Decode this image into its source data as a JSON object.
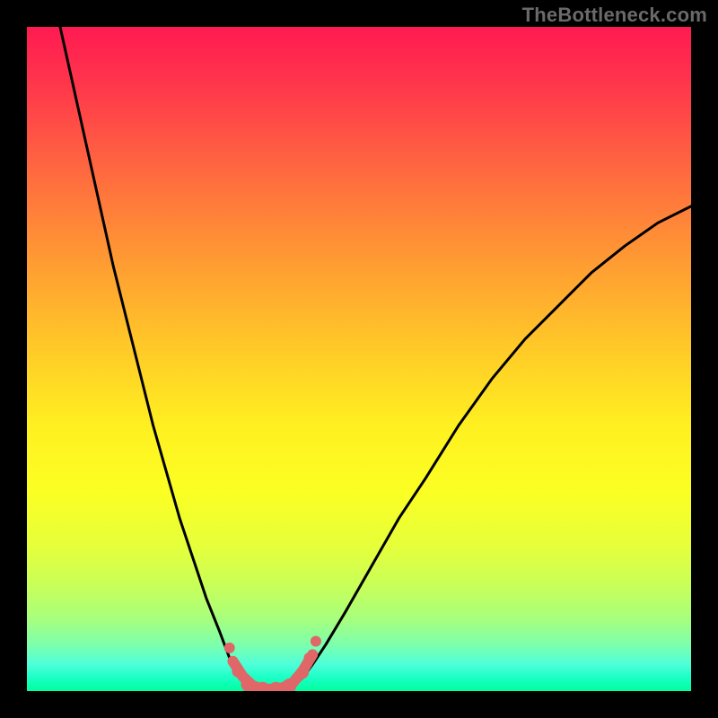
{
  "attribution": "TheBottleneck.com",
  "chart_data": {
    "type": "line",
    "title": "",
    "xlabel": "",
    "ylabel": "",
    "xlim": [
      0,
      100
    ],
    "ylim": [
      0,
      100
    ],
    "grid": false,
    "legend": false,
    "background_gradient": {
      "top": "#ff1a52",
      "mid": "#fff021",
      "bottom": "#00ff9c"
    },
    "series": [
      {
        "name": "left-branch",
        "stroke": "#000000",
        "x": [
          5,
          7,
          9,
          11,
          13,
          15,
          17,
          19,
          21,
          23,
          25,
          27,
          29,
          30.5,
          32,
          33,
          34
        ],
        "y": [
          100,
          91,
          82,
          73,
          64,
          56,
          48,
          40,
          33,
          26,
          20,
          14,
          9,
          5,
          3,
          1.5,
          0.5
        ]
      },
      {
        "name": "right-branch",
        "stroke": "#000000",
        "x": [
          40,
          41.5,
          43,
          45,
          48,
          52,
          56,
          60,
          65,
          70,
          75,
          80,
          85,
          90,
          95,
          100
        ],
        "y": [
          0.5,
          2,
          4,
          7,
          12,
          19,
          26,
          32,
          40,
          47,
          53,
          58,
          63,
          67,
          70.5,
          73
        ]
      },
      {
        "name": "valley-floor",
        "stroke": "#e06767",
        "x": [
          31,
          32.5,
          34,
          35.5,
          37,
          38.5,
          40,
          41.5,
          43
        ],
        "y": [
          4.5,
          2.2,
          0.8,
          0.3,
          0.3,
          0.5,
          1.2,
          3.0,
          5.5
        ]
      }
    ],
    "markers": [
      {
        "x": 30.5,
        "y": 6.5,
        "r": 6,
        "fill": "#e06767"
      },
      {
        "x": 31.8,
        "y": 3.0,
        "r": 7,
        "fill": "#e06767"
      },
      {
        "x": 33.3,
        "y": 1.0,
        "r": 8,
        "fill": "#e06767"
      },
      {
        "x": 35.5,
        "y": 0.3,
        "r": 8,
        "fill": "#e06767"
      },
      {
        "x": 37.5,
        "y": 0.3,
        "r": 8,
        "fill": "#e06767"
      },
      {
        "x": 39.5,
        "y": 0.8,
        "r": 8,
        "fill": "#e06767"
      },
      {
        "x": 41.5,
        "y": 2.8,
        "r": 7,
        "fill": "#e06767"
      },
      {
        "x": 42.5,
        "y": 5.0,
        "r": 6,
        "fill": "#e06767"
      },
      {
        "x": 43.5,
        "y": 7.5,
        "r": 6,
        "fill": "#e06767"
      }
    ]
  }
}
